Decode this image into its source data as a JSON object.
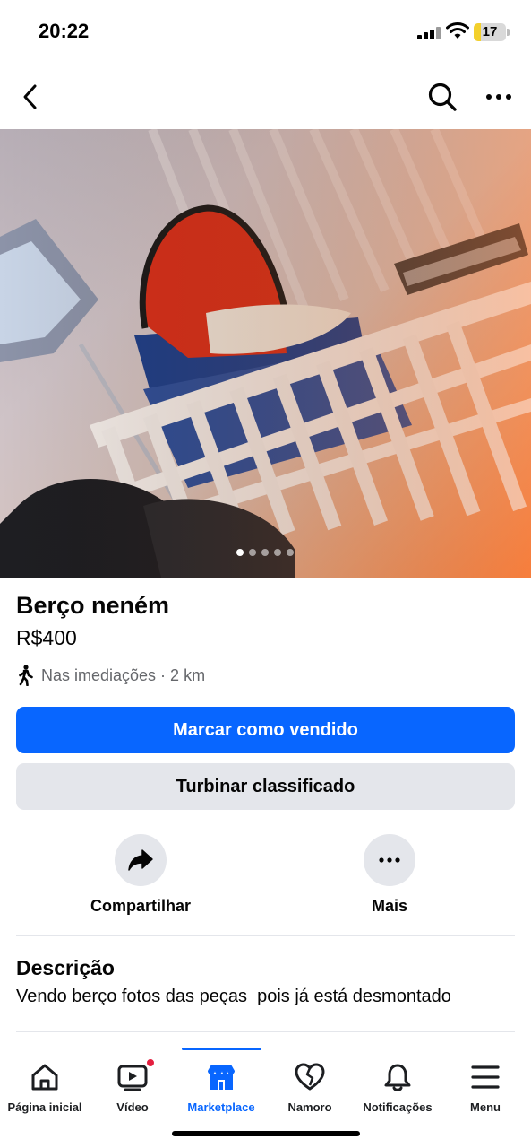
{
  "status_bar": {
    "time": "20:22",
    "battery": "17"
  },
  "nav": {
    "back_icon": "chevron-left-icon",
    "search_icon": "search-icon",
    "more_icon": "more-horizontal-icon"
  },
  "listing": {
    "photo_count": 5,
    "active_photo_index": 0,
    "title": "Berço neném",
    "price": "R$400",
    "location": "Nas imediações · 2 km",
    "location_icon": "walking-person-icon"
  },
  "buttons": {
    "primary": "Marcar como vendido",
    "secondary": "Turbinar classificado"
  },
  "actions": [
    {
      "label": "Compartilhar",
      "icon": "share-icon"
    },
    {
      "label": "Mais",
      "icon": "more-horizontal-icon"
    }
  ],
  "description": {
    "heading": "Descrição",
    "text": "Vendo berço fotos das peças  pois já está desmontado"
  },
  "tab_bar": {
    "tabs": [
      {
        "label": "Página inicial",
        "icon": "home-icon"
      },
      {
        "label": "Vídeo",
        "icon": "video-icon",
        "badge": true
      },
      {
        "label": "Marketplace",
        "icon": "marketplace-shop-icon",
        "active": true
      },
      {
        "label": "Namoro",
        "icon": "dating-heart-icon"
      },
      {
        "label": "Notificações",
        "icon": "bell-icon"
      },
      {
        "label": "Menu",
        "icon": "hamburger-menu-icon"
      }
    ]
  },
  "colors": {
    "accent": "#0866ff",
    "secondary_button": "#e4e6eb",
    "badge": "#e41e3f",
    "muted_text": "#65676b"
  }
}
